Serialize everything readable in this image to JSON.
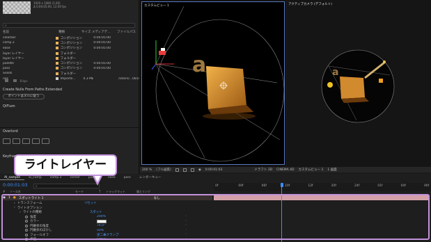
{
  "project": {
    "thumb_meta": [
      "1920 x 1080 (1.00)",
      "Δ 0;00;05;00, 12.00 fps"
    ],
    "columns": [
      "名前",
      "種類",
      "サイズ",
      "メディアデ…",
      "ファイルパス"
    ],
    "items": [
      {
        "name": "colorbar",
        "swatch": "#e8b15b",
        "kind": "コンポジション",
        "size": "",
        "media": "0:00:05:00",
        "path": ""
      },
      {
        "name": "comp 2",
        "swatch": "#e8b15b",
        "kind": "コンポジション",
        "size": "",
        "media": "0:00:05:00",
        "path": ""
      },
      {
        "name": "ease",
        "swatch": "#e8b15b",
        "kind": "コンポジション",
        "size": "",
        "media": "0:00:05:00",
        "path": ""
      },
      {
        "name": "layer レイヤー",
        "swatch": "#e8b15b",
        "kind": "フォルダー",
        "size": "",
        "media": "",
        "path": ""
      },
      {
        "name": "layer レイヤー",
        "swatch": "#e8b15b",
        "kind": "フォルダー",
        "size": "",
        "media": "",
        "path": ""
      },
      {
        "name": "palette",
        "swatch": "#e8b15b",
        "kind": "コンポジション",
        "size": "",
        "media": "0:00:05:00",
        "path": ""
      },
      {
        "name": "pass",
        "swatch": "#e8b15b",
        "kind": "コンポジション",
        "size": "",
        "media": "0:00:05:00",
        "path": ""
      },
      {
        "name": "Solids",
        "swatch": "#e8b15b",
        "kind": "フォルダー",
        "size": "",
        "media": "",
        "path": ""
      },
      {
        "name": "nes",
        "swatch": "#cfcfcf",
        "kind": "Importe...",
        "size": "4.3 MB",
        "media": "",
        "path": "/Users/...0814.jp"
      }
    ],
    "footer": "8 bpc"
  },
  "create_nulls": {
    "title": "Create Nulls From Paths Extended",
    "button": "ポイントはヌルに従う"
  },
  "qiflum": {
    "title": "QiFlum"
  },
  "overlord": {
    "title": "Overlord"
  },
  "keyframe": {
    "title": "Keyframe"
  },
  "viewer": {
    "custom_title": "カスタムビュー 1",
    "active_title": "アクティブカメラ (デフォルト)",
    "zoom": "200 %",
    "quality": "(フル画質)",
    "timecode": "0:00:01:03",
    "draft": "ドラフト 3D",
    "renderer": "CINEMA 4D",
    "view": "カスタムビュー 1",
    "views": "1 画面"
  },
  "timeline": {
    "tabs": [
      "AI_sample",
      "ai_comp",
      "comp 2",
      "corner",
      "palette",
      "ease",
      "pass",
      "レンダーキュー"
    ],
    "active_tab": 0,
    "timecode": "0:00:01:03",
    "ruler_labels": [
      "0f",
      "00f",
      "06f",
      "10f",
      "12f",
      "20f",
      "24f",
      "01f",
      "04f",
      "06f"
    ],
    "layer_columns": [
      "#",
      "ソース名",
      "モード",
      "T",
      "トラックマット",
      "親とリンク"
    ],
    "layer": {
      "index": "1",
      "name": "スポットライト 1",
      "parent": "なし"
    },
    "properties": [
      {
        "label": "トランスフォーム",
        "value": "リセット",
        "indent": 1
      },
      {
        "label": "ライトオプション",
        "value": "",
        "indent": 1
      },
      {
        "label": "ライトの種類",
        "value": "スポット",
        "indent": 2
      },
      {
        "label": "強度",
        "value": "200%",
        "indent": 3
      },
      {
        "label": "カラー",
        "value": "",
        "indent": 3
      },
      {
        "label": "円錐状の角度",
        "value": "74.0°",
        "indent": 3
      },
      {
        "label": "円錐状のぼかし",
        "value": "50%",
        "indent": 3
      },
      {
        "label": "フォールオフ",
        "value": "逆二乗クランプ",
        "indent": 3
      },
      {
        "label": "半径",
        "value": "500.0",
        "indent": 3
      }
    ]
  },
  "callout": {
    "text": "ライトレイヤー"
  },
  "colors": {
    "accent": "#3d8fff",
    "selection": "#c292dc",
    "layer_bar": "#d4a0a8",
    "light": "#e8a03a"
  }
}
